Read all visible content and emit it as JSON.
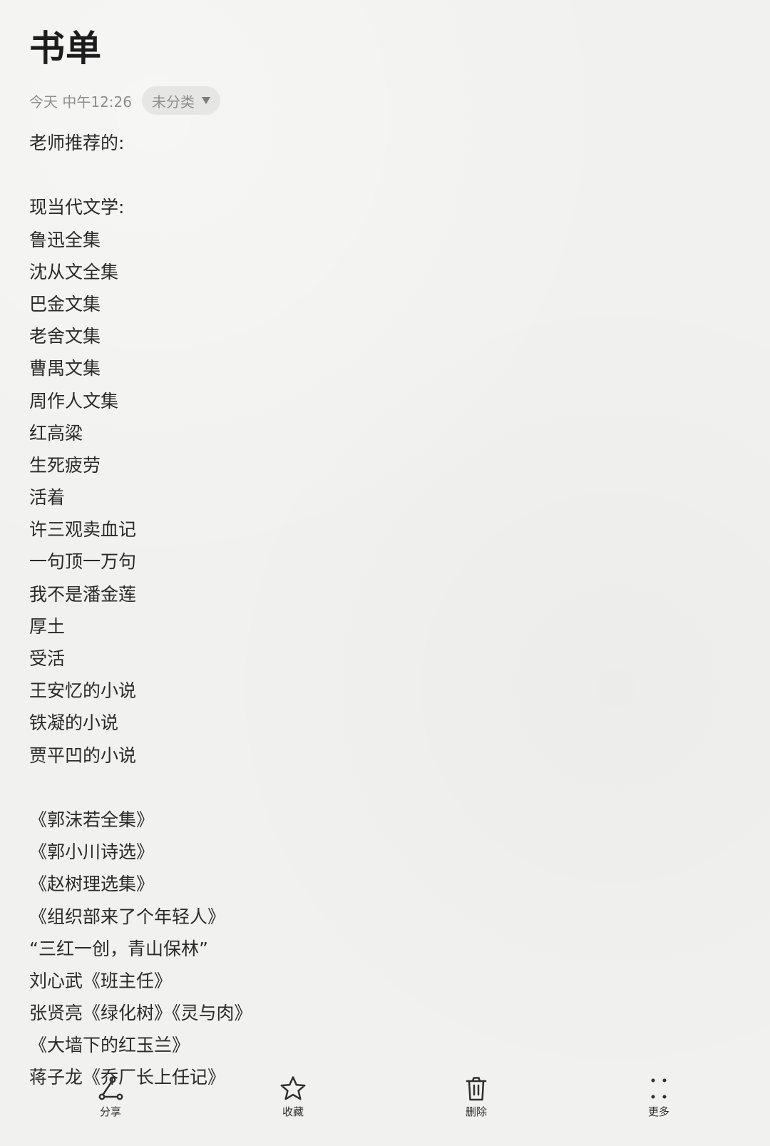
{
  "note": {
    "title": "书单",
    "timestamp": "今天 中午12:26",
    "category": "未分类",
    "lines": [
      "老师推荐的:",
      "",
      "现当代文学:",
      "鲁迅全集",
      "沈从文全集",
      "巴金文集",
      "老舍文集",
      "曹禺文集",
      "周作人文集",
      "红高粱",
      "生死疲劳",
      "活着",
      "许三观卖血记",
      "一句顶一万句",
      "我不是潘金莲",
      "厚土",
      "受活",
      "王安忆的小说",
      "铁凝的小说",
      "贾平凹的小说",
      "",
      "《郭沫若全集》",
      "《郭小川诗选》",
      "《赵树理选集》",
      "《组织部来了个年轻人》",
      "“三红一创，青山保林”",
      "刘心武《班主任》",
      "张贤亮《绿化树》《灵与肉》",
      "《大墙下的红玉兰》",
      "蒋子龙《乔厂长上任记》"
    ]
  },
  "icons": {
    "category_dropdown": "triangle-down-icon",
    "share": "share-icon",
    "favorite": "star-icon",
    "delete": "trash-icon",
    "more": "more-dots-icon"
  },
  "toolbar": {
    "share_label": "分享",
    "favorite_label": "收藏",
    "delete_label": "删除",
    "more_label": "更多"
  },
  "colors": {
    "background": "#f1f1ef",
    "chip_background": "#e6e6e4",
    "text": "#262626",
    "secondary_text": "#8e8e8e"
  }
}
